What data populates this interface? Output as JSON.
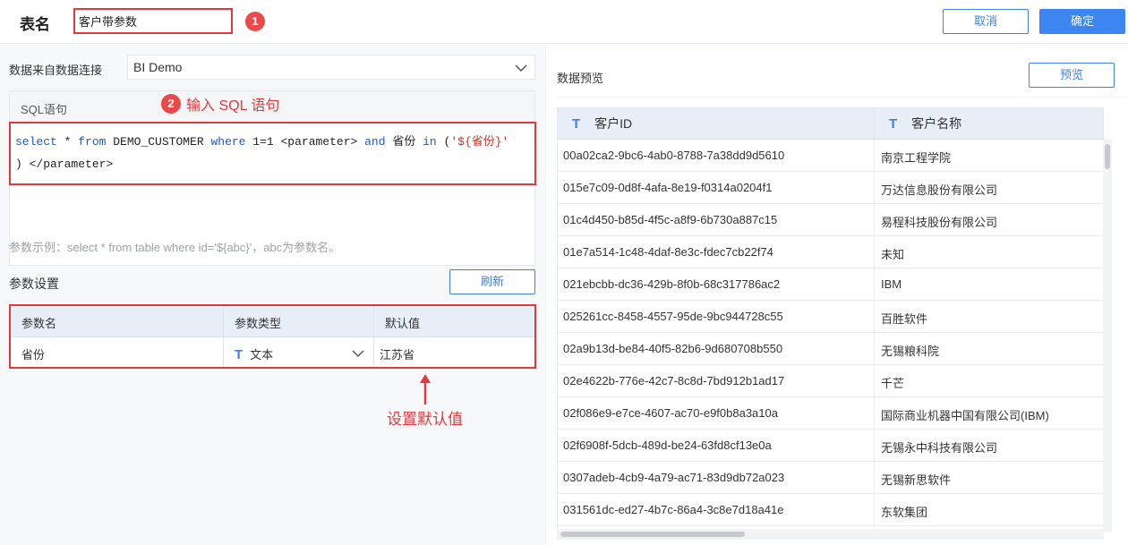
{
  "header": {
    "label": "表名",
    "table_name": "客户带参数",
    "callout1": "1",
    "cancel": "取消",
    "confirm": "确定"
  },
  "left": {
    "source_label": "数据来自数据连接",
    "source_value": "BI Demo",
    "sql_title": "SQL语句",
    "callout2": "2",
    "sql_annotation": "输入 SQL 语句",
    "sql_line1": {
      "p1": "select",
      "p2": " * ",
      "p3": "from",
      "p4": " DEMO_CUSTOMER ",
      "p5": "where",
      "p6": " 1=1 <parameter> ",
      "p7": "and",
      "p8": " 省份 ",
      "p9": "in",
      "p10": " (",
      "p11": "'${省份}'"
    },
    "sql_line2": ") </parameter>",
    "hint": "参数示例：select * from table where id='${abc}'，abc为参数名。",
    "param_title": "参数设置",
    "refresh": "刷新",
    "param_headers": [
      "参数名",
      "参数类型",
      "默认值"
    ],
    "param_row": {
      "name": "省份",
      "type_icon": "T",
      "type": "文本",
      "default": "江苏省"
    },
    "default_annotation": "设置默认值"
  },
  "right": {
    "preview_title": "数据预览",
    "preview_button": "预览",
    "columns": [
      {
        "icon": "T",
        "name": "客户ID"
      },
      {
        "icon": "T",
        "name": "客户名称"
      }
    ],
    "rows": [
      [
        "00a02ca2-9bc6-4ab0-8788-7a38dd9d5610",
        "南京工程学院"
      ],
      [
        "015e7c09-0d8f-4afa-8e19-f0314a0204f1",
        "万达信息股份有限公司"
      ],
      [
        "01c4d450-b85d-4f5c-a8f9-6b730a887c15",
        "易程科技股份有限公司"
      ],
      [
        "01e7a514-1c48-4daf-8e3c-fdec7cb22f74",
        "未知"
      ],
      [
        "021ebcbb-dc36-429b-8f0b-68c317786ac2",
        "IBM"
      ],
      [
        "025261cc-8458-4557-95de-9bc944728c55",
        "百胜软件"
      ],
      [
        "02a9b13d-be84-40f5-82b6-9d680708b550",
        "无锡粮科院"
      ],
      [
        "02e4622b-776e-42c7-8c8d-7bd912b1ad17",
        "千芒"
      ],
      [
        "02f086e9-e7ce-4607-ac70-e9f0b8a3a10a",
        "国际商业机器中国有限公司(IBM)"
      ],
      [
        "02f6908f-5dcb-489d-be24-63fd8cf13e0a",
        "无锡永中科技有限公司"
      ],
      [
        "0307adeb-4cb9-4a79-ac71-83d9db72a023",
        "无锡新思软件"
      ],
      [
        "031561dc-ed27-4b7c-86a4-3c8e7d18a41e",
        "东软集团"
      ]
    ]
  },
  "colors": {
    "accent": "#3d85f0",
    "highlight": "#e0393e"
  }
}
